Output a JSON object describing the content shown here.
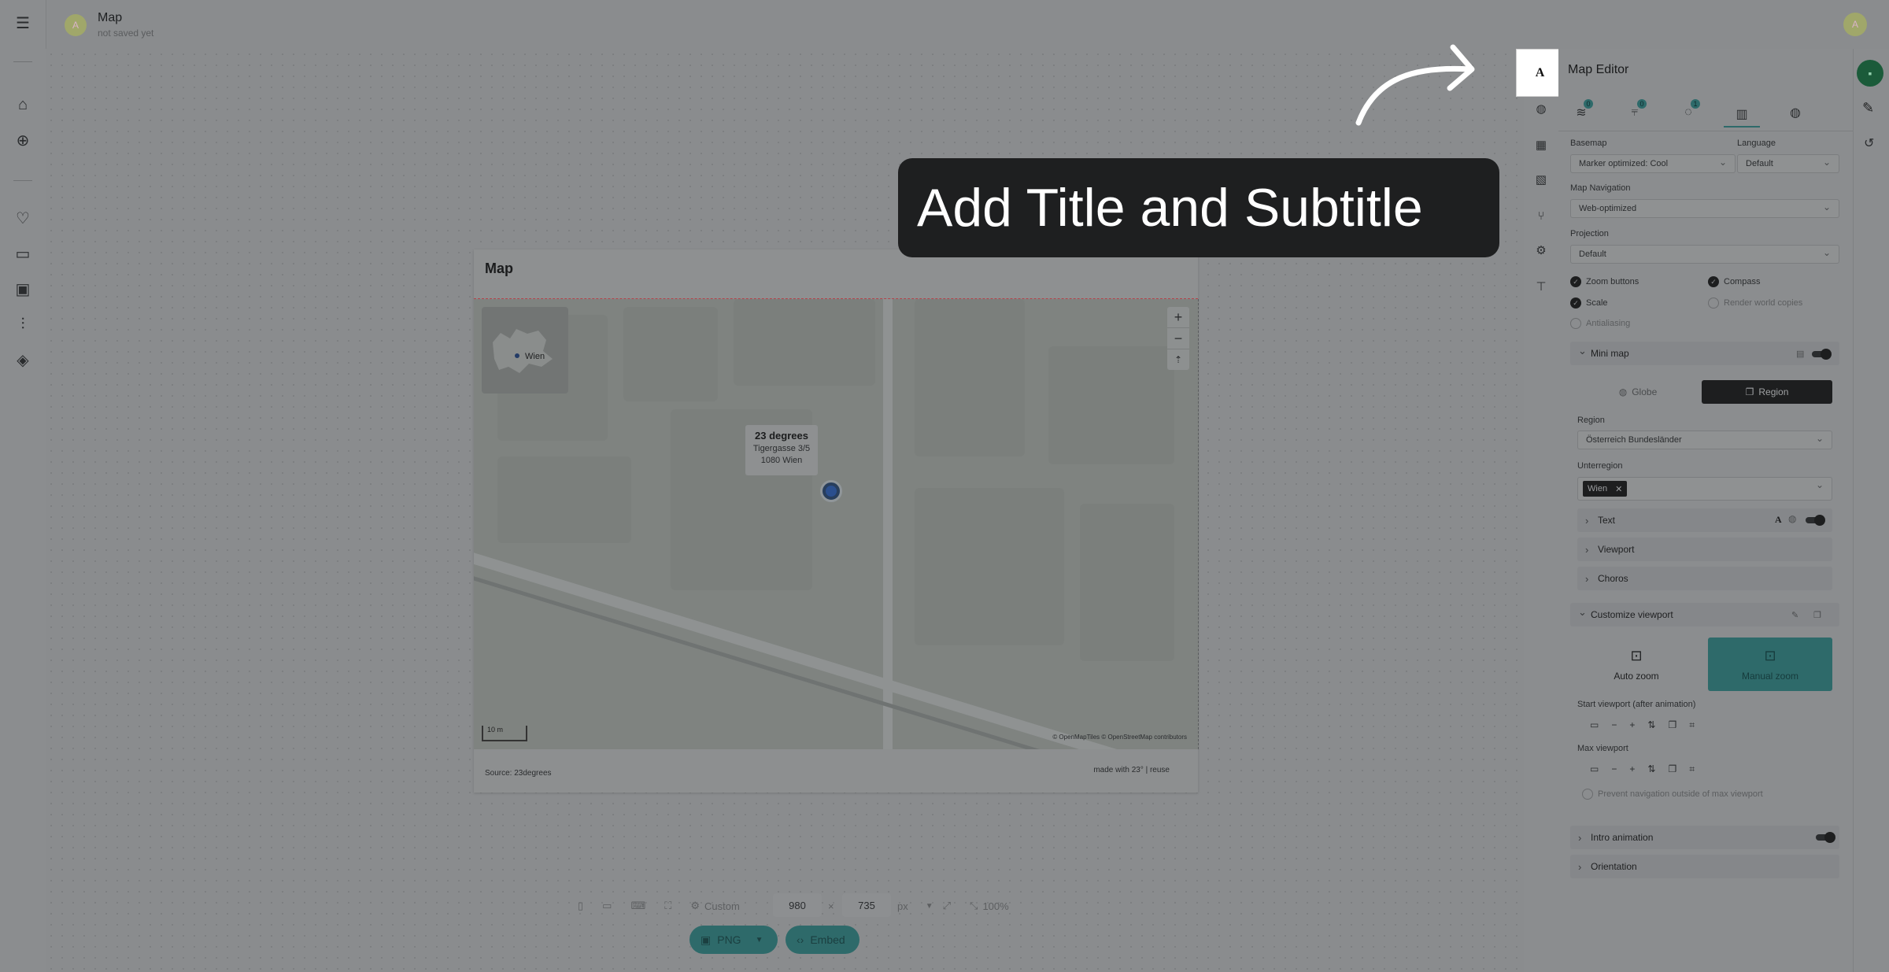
{
  "app": {
    "title": "Map",
    "subtitle": "not saved yet",
    "avatar_letter": "A"
  },
  "left_nav": {
    "icons": [
      "menu-icon",
      "home-icon",
      "add-icon",
      "heart-icon",
      "folder-icon",
      "image-icon",
      "sliders-icon",
      "graduation-cap-icon"
    ]
  },
  "overlay": {
    "tooltip_text": "Add Title and Subtitle",
    "highlight_glyph": "A"
  },
  "map_card": {
    "title": "Map",
    "minimap_label": "Wien",
    "zoom_in": "+",
    "zoom_out": "−",
    "compass": "⇡",
    "popup": {
      "title": "23 degrees",
      "line1": "Tigergasse 3/5",
      "line2": "1080 Wien"
    },
    "scale_label": "10 m",
    "attribution": "© OpenMapTiles © OpenStreetMap contributors",
    "source": "Source: 23degrees",
    "made_with": "made with 23° | reuse"
  },
  "bottom_toolbar": {
    "preset": "Custom",
    "width": "980",
    "times": "×",
    "height": "735",
    "unit": "px",
    "zoom": "100%",
    "export_format": "PNG",
    "embed_label": "Embed"
  },
  "editor": {
    "title": "Map Editor",
    "tabs": [
      {
        "icon": "layers-icon",
        "badge": "0"
      },
      {
        "icon": "filter-icon",
        "badge": "0"
      },
      {
        "icon": "pin-icon",
        "badge": "1"
      },
      {
        "icon": "map-icon",
        "badge": ""
      },
      {
        "icon": "globe-icon",
        "badge": ""
      }
    ],
    "basemap_label": "Basemap",
    "basemap_value": "Marker optimized: Cool",
    "language_label": "Language",
    "language_value": "Default",
    "navigation_label": "Map Navigation",
    "navigation_value": "Web-optimized",
    "projection_label": "Projection",
    "projection_value": "Default",
    "options": {
      "zoom_buttons": "Zoom buttons",
      "compass": "Compass",
      "scale": "Scale",
      "render_world_copies": "Render world copies",
      "antialiasing": "Antialiasing"
    },
    "mini_map": {
      "label": "Mini map",
      "globe": "Globe",
      "region": "Region",
      "region_label": "Region",
      "region_value": "Österreich Bundesländer",
      "subregion_label": "Unterregion",
      "subregion_tag": "Wien",
      "text": "Text",
      "viewport": "Viewport",
      "choros": "Choros"
    },
    "customize_viewport": {
      "label": "Customize viewport",
      "auto_zoom": "Auto zoom",
      "manual_zoom": "Manual zoom",
      "start_label": "Start viewport (after animation)",
      "max_label": "Max viewport",
      "prevent_nav": "Prevent navigation outside of max viewport"
    },
    "intro_animation": "Intro animation",
    "orientation": "Orientation"
  },
  "colors": {
    "accent": "#2e6a6a",
    "save": "#1b5b3a",
    "overlay_tooltip_bg": "#1e1f20"
  }
}
